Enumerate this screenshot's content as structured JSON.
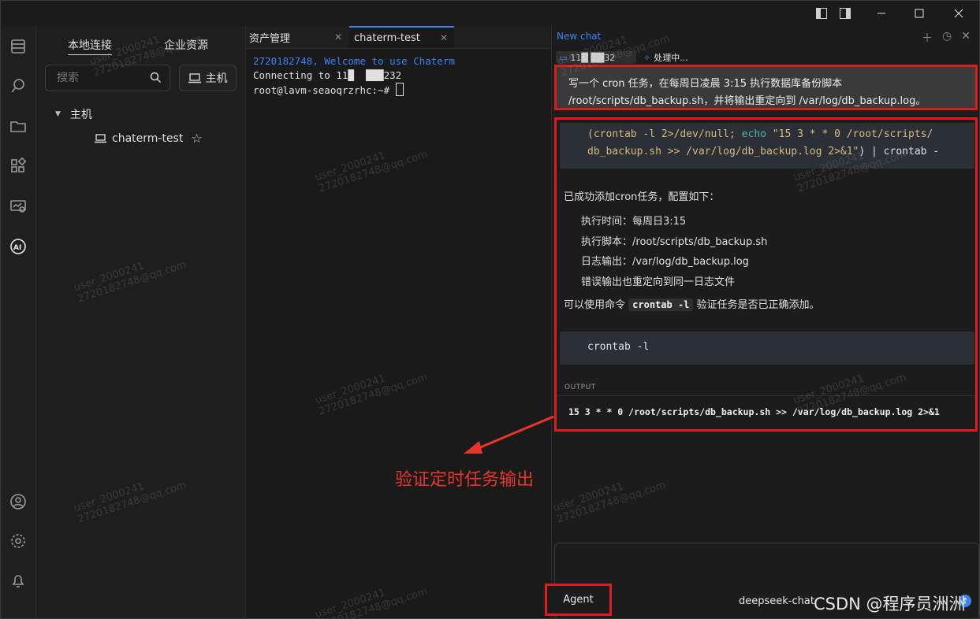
{
  "sidebar": {
    "tabs": [
      "本地连接",
      "企业资源"
    ],
    "search_placeholder": "搜索",
    "host_button": "主机",
    "tree_group": "主机",
    "tree_item": "chaterm-test"
  },
  "terminal": {
    "tabs": [
      "资产管理",
      "chaterm-test"
    ],
    "lines": [
      "2720182748, Welcome to use Chaterm",
      "",
      "Connecting to 11█  ███232",
      "root@lavm-seaoqrzrhc:~# "
    ]
  },
  "chat": {
    "title": "New chat",
    "host_chip": "11█  ██32",
    "status_chip": "处理中...",
    "user_message": [
      "写一个 cron 任务，在每周日凌晨 3:15 执行数据库备份脚本",
      "/root/scripts/db_backup.sh，并将输出重定向到 /var/log/db_backup.log。"
    ],
    "code_block": {
      "part1": "(crontab -l 2>/dev/null; ",
      "echo": "echo",
      "str1": " \"15 3 * * 0 /root/scripts/",
      "str2": "db_backup.sh >> /var/log/db_backup.log 2>&1\"",
      "part2": ") | crontab -"
    },
    "success_text": "已成功添加cron任务，配置如下：",
    "details": [
      "执行时间：每周日3:15",
      "执行脚本：/root/scripts/db_backup.sh",
      "日志输出：/var/log/db_backup.log",
      "错误输出也重定向到同一日志文件"
    ],
    "verify_prefix": "可以使用命令",
    "verify_cmd": "crontab -l",
    "verify_suffix": "验证任务是否已正确添加。",
    "code_block2": "crontab -l",
    "output_label": "OUTPUT",
    "output_text": "15 3 * * 0 /root/scripts/db_backup.sh >> /var/log/db_backup.log 2>&1",
    "agent_button": "Agent",
    "model": "deepseek-chat"
  },
  "annotation": "验证定时任务输出",
  "watermark": [
    "user_2000241",
    "2720182748@qq.com"
  ],
  "csdn": "CSDN @程序员洲洲",
  "colors": {
    "accent": "#3b82f6",
    "annotation_red": "#e01b1b"
  }
}
